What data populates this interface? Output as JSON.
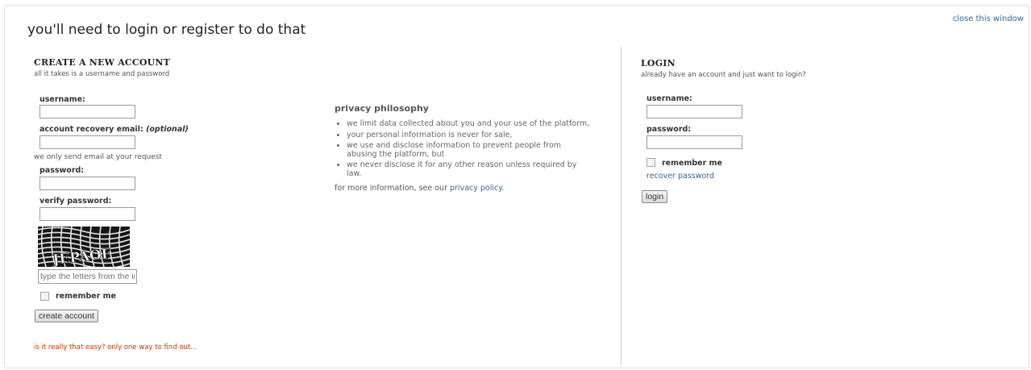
{
  "window": {
    "title": "you'll need to login or register to do that",
    "close_label": "close this window"
  },
  "register": {
    "title": "CREATE A NEW ACCOUNT",
    "subtitle": "all it takes is a username and password",
    "username_label": "username:",
    "email_label": "account recovery email:",
    "email_optional": "(optional)",
    "email_note": "we only send email at your request",
    "password_label": "password:",
    "verify_label": "verify password:",
    "captcha_text": "JEPAOF",
    "captcha_placeholder": "type the letters from the image above",
    "remember_label": "remember me",
    "submit_label": "create account",
    "tagline": "is it really that easy? only one way to find out..."
  },
  "privacy": {
    "title": "privacy philosophy",
    "items": [
      "we limit data collected about you and your use of the platform,",
      "your personal information is never for sale,",
      "we use and disclose information to prevent people from abusing the platform, but",
      "we never disclose it for any other reason unless required by law."
    ],
    "footer_prefix": "for more information, see our ",
    "footer_link": "privacy policy",
    "footer_suffix": "."
  },
  "login": {
    "title": "LOGIN",
    "subtitle": "already have an account and just want to login?",
    "username_label": "username:",
    "password_label": "password:",
    "remember_label": "remember me",
    "recover_label": "recover password",
    "submit_label": "login"
  },
  "colors": {
    "link": "#336699",
    "tagline": "#cc3300"
  }
}
